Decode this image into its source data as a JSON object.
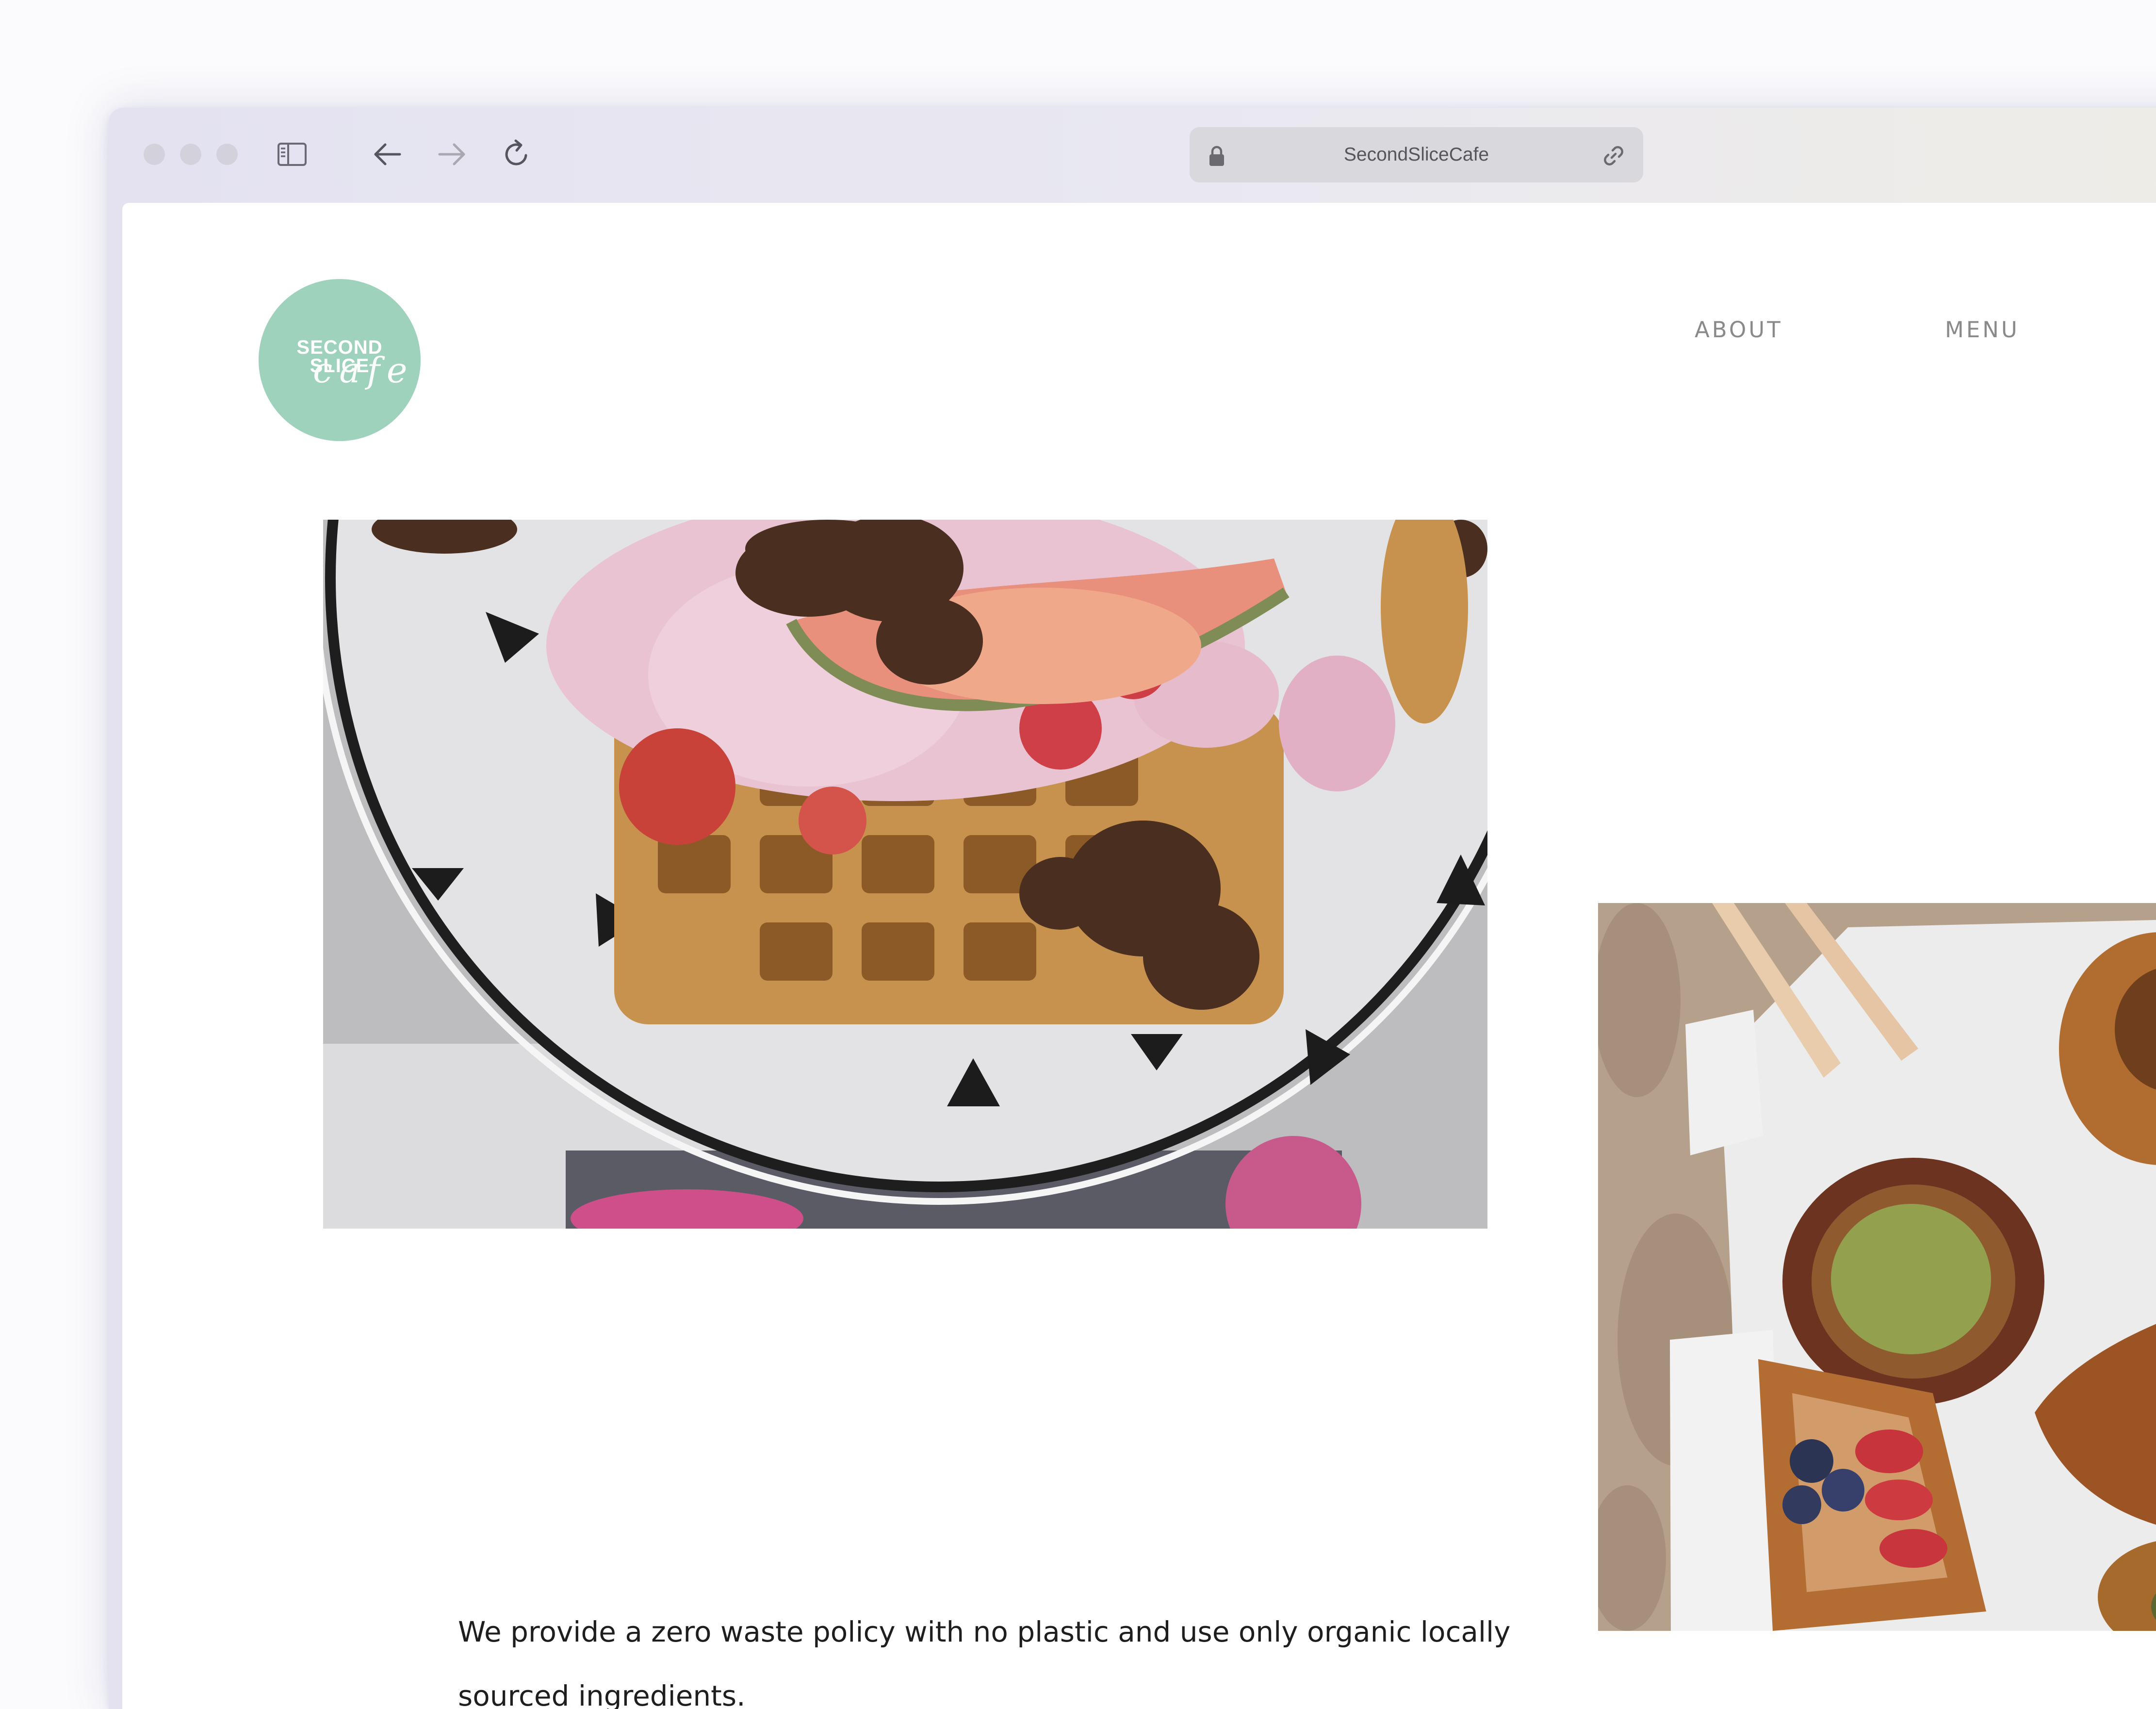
{
  "browser": {
    "url": "SecondSliceCafe",
    "chrome_color_left": "#e4e2f1",
    "chrome_color_right": "#efede6"
  },
  "logo": {
    "line1": "SECOND",
    "line2": "SLICE",
    "script": "cafe",
    "color": "#9ed2bd"
  },
  "nav": {
    "items": [
      {
        "label": "ABOUT"
      },
      {
        "label": "MENU"
      }
    ]
  },
  "content": {
    "description": "We provide a zero waste policy with no plastic and use only organic locally sourced ingredients."
  }
}
